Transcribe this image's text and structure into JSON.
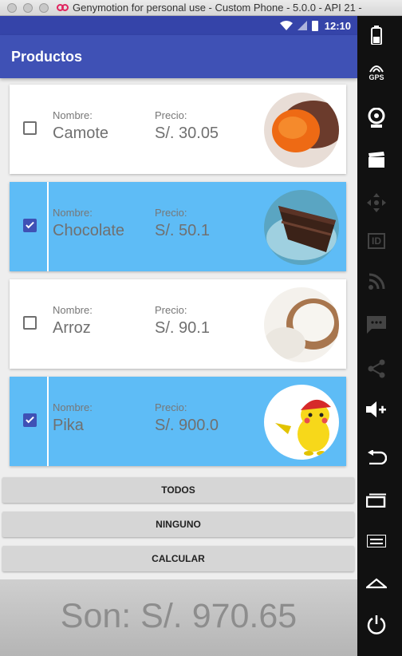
{
  "window": {
    "title": "Genymotion for personal use - Custom Phone - 5.0.0 - API 21 -"
  },
  "statusbar": {
    "time": "12:10"
  },
  "appbar": {
    "title": "Productos"
  },
  "products": [
    {
      "name_label": "Nombre:",
      "name": "Camote",
      "price_label": "Precio:",
      "price": "S/. 30.05",
      "selected": false,
      "image": "sweet-potato"
    },
    {
      "name_label": "Nombre:",
      "name": "Chocolate",
      "price_label": "Precio:",
      "price": "S/. 50.1",
      "selected": true,
      "image": "chocolate-cake"
    },
    {
      "name_label": "Nombre:",
      "name": "Arroz",
      "price_label": "Precio:",
      "price": "S/. 90.1",
      "selected": false,
      "image": "rice-bowl"
    },
    {
      "name_label": "Nombre:",
      "name": "Pika",
      "price_label": "Precio:",
      "price": "S/. 900.0",
      "selected": true,
      "image": "pikachu"
    }
  ],
  "buttons": {
    "all": "TODOS",
    "none": "NINGUNO",
    "calculate": "CALCULAR"
  },
  "total": "Son: S/. 970.65",
  "sidebar": {
    "gps_label": "GPS",
    "id_label": "ID",
    "icons": [
      "battery-icon",
      "gps-icon",
      "webcam-icon",
      "clapperboard-icon",
      "dpad-icon",
      "id-icon",
      "rss-icon",
      "sms-icon",
      "share-icon",
      "volume-up-icon",
      "back-icon",
      "recent-apps-icon",
      "menu-icon",
      "home-icon",
      "power-icon"
    ]
  },
  "colors": {
    "appbar": "#3f51b5",
    "statusbar": "#3544a9",
    "selected_card": "#5ebcf6",
    "sidebar": "#111111"
  }
}
